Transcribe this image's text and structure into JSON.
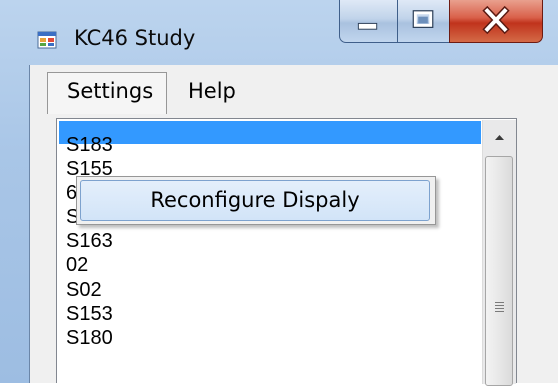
{
  "window": {
    "title": "KC46 Study",
    "icon": "windows-forms-app-icon",
    "controls": {
      "minimize": "minimize-icon",
      "maximize": "maximize-icon",
      "close": "close-icon"
    }
  },
  "menubar": {
    "settings_label": "Settings",
    "help_label": "Help"
  },
  "settings_menu": {
    "items": [
      {
        "label": "Reconfigure Dispaly"
      }
    ]
  },
  "listbox": {
    "items": [
      "S183",
      "S155",
      "6",
      "S06",
      "S163",
      "02",
      "S02",
      "S153",
      "S180"
    ],
    "selected_index": 0
  },
  "colors": {
    "selection": "#3399ff",
    "close_button": "#c0331c",
    "menu_highlight": "#d2e4f8"
  }
}
